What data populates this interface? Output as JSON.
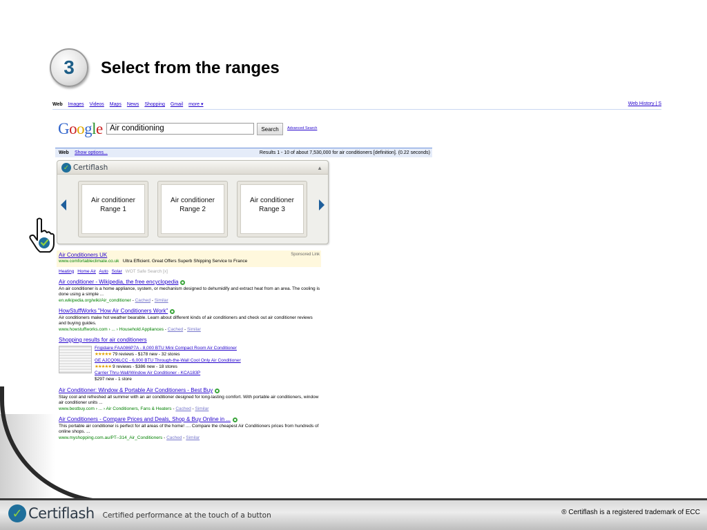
{
  "step": {
    "number": "3",
    "title": "Select from the ranges"
  },
  "google": {
    "topnav": {
      "web": "Web",
      "links": [
        "Images",
        "Videos",
        "Maps",
        "News",
        "Shopping",
        "Gmail",
        "more ▾"
      ],
      "right": "Web History | S"
    },
    "logo": [
      "G",
      "o",
      "o",
      "g",
      "l",
      "e"
    ],
    "search": {
      "value": "Air conditioning",
      "button": "Search",
      "advanced": "Advanced Search"
    },
    "results_bar": {
      "web": "Web",
      "options": "Show options...",
      "stats": "Results 1 - 10 of about 7,530,000 for air conditioners [definition]. (0.22 seconds)"
    }
  },
  "certiflash_panel": {
    "logo": "Certiflash",
    "cards": [
      {
        "line1": "Air conditioner",
        "line2": "Range 1"
      },
      {
        "line1": "Air conditioner",
        "line2": "Range 2"
      },
      {
        "line1": "Air conditioner",
        "line2": "Range 3"
      }
    ]
  },
  "results": {
    "sponsored": {
      "title": "Air Conditioners UK",
      "url": "www.comfortableclimate.co.uk",
      "desc": "Ultra Efficient. Great Offers Superb Shipping Service to France",
      "tag": "Sponsored Link"
    },
    "refine": [
      "Heating",
      "Home Air",
      "Auto",
      "Solar"
    ],
    "refine_extra": "WOT Safe Search [x]",
    "items": [
      {
        "title": "Air conditioner - Wikipedia, the free encyclopedia",
        "desc": "An air conditioner is a home appliance, system, or mechanism designed to dehumidify and extract heat from an area. The cooling is done using a simple ...",
        "url": "en.wikipedia.org/wiki/Air_conditioner",
        "cached": "Cached",
        "similar": "Similar"
      },
      {
        "title": "HowStuffWorks \"How Air Conditioners Work\"",
        "desc": "Air conditioners make hot weather bearable. Learn about different kinds of air conditioners and check out air conditioner reviews and buying guides.",
        "url": "www.howstuffworks.com › ... › Household Appliances",
        "cached": "Cached",
        "similar": "Similar"
      }
    ],
    "shopping": {
      "title": "Shopping results for air conditioners",
      "items": [
        {
          "name": "Frigidaire FAA086P7A - 8,000 BTU Mini Compact Room Air Conditioner",
          "meta": "79 reviews - $178 new - 32 stores"
        },
        {
          "name": "GE AJCQ06LCC - 6,000 BTU Through-the-Wall Cool Only Air Conditioner",
          "meta": "9 reviews - $386 new - 18 stores"
        },
        {
          "name": "Carrier Thru-Wall/Window Air Conditioner - KCA183P",
          "meta": "$297 new - 1 store"
        }
      ]
    },
    "items2": [
      {
        "title": "Air Conditioner: Window & Portable Air Conditioners - Best Buy",
        "desc": "Stay cool and refreshed all summer with an air conditioner designed for long-lasting comfort. With portable air conditioners, window air conditioner units ...",
        "url": "www.bestbuy.com › ... › Air Conditioners, Fans & Heaters",
        "cached": "Cached",
        "similar": "Similar"
      },
      {
        "title": "Air Conditioners - Compare Prices and Deals, Shop & Buy Online in ...",
        "desc": "This portable air conditioner is perfect for all areas of the home! .... Compare the cheapest Air Conditioners prices from hundreds of online shops. ...",
        "url": "www.myshopping.com.au/PT--314_Air_Conditioners",
        "cached": "Cached",
        "similar": "Similar"
      }
    ]
  },
  "footer": {
    "brand": "Certiflash",
    "tagline": "Certified performance at the touch of a button",
    "trademark": "® Certiflash is a registered trademark of ECC"
  },
  "colors": {
    "accent_blue": "#1f5f88",
    "link": "#2200cc",
    "url_green": "#008000",
    "check_green": "#8fd13f"
  }
}
